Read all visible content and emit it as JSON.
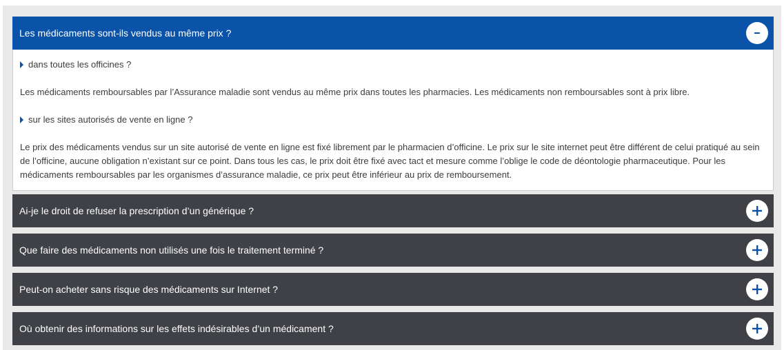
{
  "faq": {
    "items": [
      {
        "question": "Les médicaments sont-ils vendus au même prix ?",
        "state": "expanded",
        "toggle_icon": "minus-icon",
        "sections": [
          {
            "subquestion": "dans toutes les officines ?",
            "answer": "Les médicaments remboursables par l’Assurance maladie sont vendus au même prix dans toutes les pharmacies. Les médicaments non remboursables sont à prix libre."
          },
          {
            "subquestion": "sur les sites autorisés de vente en ligne ?",
            "answer": "Le prix des médicaments vendus sur un site autorisé de vente en ligne est fixé librement par le pharmacien d’officine. Le prix sur le site internet peut être différent de celui pratiqué au sein de l’officine, aucune obligation n’existant sur ce point. Dans tous les cas, le prix doit être fixé avec tact et mesure comme l’oblige le code de déontologie pharmaceutique. Pour les médicaments remboursables par les organismes d’assurance maladie, ce prix peut être inférieur au prix de remboursement."
          }
        ]
      },
      {
        "question": "Ai-je le droit de refuser la prescription d’un générique ?",
        "state": "collapsed",
        "toggle_icon": "plus-icon"
      },
      {
        "question": "Que faire des médicaments non utilisés une fois le traitement terminé ?",
        "state": "collapsed",
        "toggle_icon": "plus-icon"
      },
      {
        "question": "Peut-on acheter sans risque des médicaments sur Internet ?",
        "state": "collapsed",
        "toggle_icon": "plus-icon"
      },
      {
        "question": "Où obtenir des informations sur les effets indésirables d’un médicament ?",
        "state": "collapsed",
        "toggle_icon": "plus-icon"
      }
    ]
  },
  "colors": {
    "open_header": "#0a53a8",
    "closed_header": "#3f4146",
    "panel_background": "#e9e9e9",
    "body_text": "#3c3c3c"
  }
}
